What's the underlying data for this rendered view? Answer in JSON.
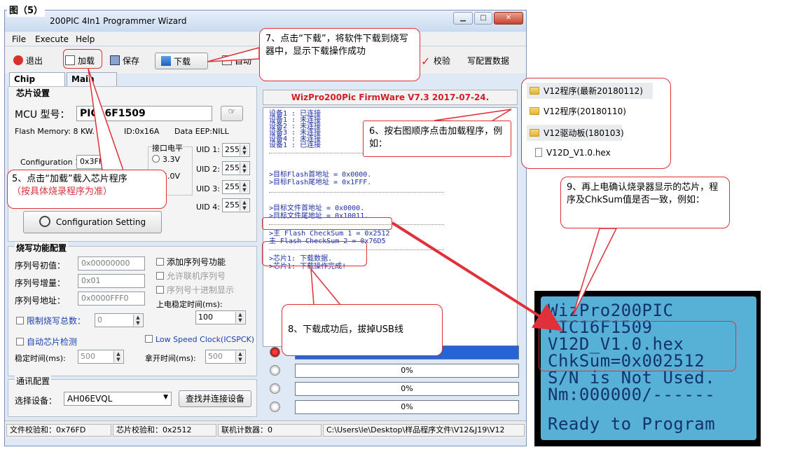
{
  "figure_label": "图（5）",
  "window": {
    "title": "200PIC 4In1 Programmer Wizard",
    "menu": [
      "File",
      "Execute",
      "Help"
    ],
    "toolbar": {
      "exit": "退出",
      "load": "加载",
      "save": "保存",
      "download": "下载",
      "auto": "自动",
      "verify": "校验",
      "write_config": "写配置数据"
    },
    "tabs": [
      "Chip Setting",
      "Main Flash"
    ],
    "chip": {
      "group_title": "芯片设置",
      "mcu_label": "MCU 型号：",
      "mcu_value": "PIC16F1509",
      "flash_memory": "Flash Memory: 8 KW.",
      "id": "ID:0x16A",
      "eeprom": "Data EEP:NILL",
      "config_label": "Configuration 1:",
      "config_value": "0x3FF",
      "voltage_group": "接口电平",
      "v33": "3.3V",
      "v5": "5.0V",
      "uids": [
        {
          "label": "UID 1:",
          "value": "255"
        },
        {
          "label": "UID 2:",
          "value": "255"
        },
        {
          "label": "UID 3:",
          "value": "255"
        },
        {
          "label": "UID 4:",
          "value": "255"
        }
      ],
      "config_button": "Configuration Setting"
    },
    "burn": {
      "group_title": "烧写功能配置",
      "serial_init_label": "序列号初值：",
      "serial_init_value": "0x00000000",
      "serial_inc_label": "序列号增量：",
      "serial_inc_value": "0x01",
      "serial_addr_label": "序列号地址：",
      "serial_addr_value": "0x0000FFF0",
      "add_serial": "添加序列号功能",
      "allow_online": "允许联机序列号",
      "decimal_show": "序列号十进制显示",
      "power_delay_label": "上电稳定时间(ms):",
      "power_delay_value": "100",
      "limit_total": "限制烧写总数：",
      "limit_value": "0",
      "auto_detect": "自动芯片检测",
      "low_speed": "Low Speed Clock(ICSPCK)",
      "stable_label": "稳定时间(ms):",
      "stable_value": "500",
      "release_label": "拿开时间(ms):",
      "release_value": "500"
    },
    "comm": {
      "group_title": "通讯配置",
      "device_label": "选择设备：",
      "device_value": "AH06EVQL",
      "connect_button": "查找并连接设备"
    },
    "firmware_banner": "WizPro200Pic FirmWare V7.3 2017-07-24.",
    "log": [
      "设备1 : 已连接",
      "设备1 : 未连接",
      "设备2 : 未连接",
      "设备3 : 未连接",
      "设备4 : 未连接",
      "设备1 : 已连接",
      ">目标Flash首地址 = 0x0000.",
      ">目标Flash尾地址 = 0x1FFF.",
      ">目标文件首地址 = 0x0000.",
      ">目标文件尾地址 = 0x10011.",
      ">主 Flash CheckSum 1 = 0x2512",
      " 主 Flash CheckSum 2 = 0x76D5",
      ">芯片1: 下载数据.",
      ">芯片1: 下载操作完成!"
    ],
    "progress": [
      {
        "label": "",
        "value": 1.0
      },
      {
        "label": "0%",
        "value": 0
      },
      {
        "label": "0%",
        "value": 0
      },
      {
        "label": "0%",
        "value": 0
      }
    ],
    "status": {
      "file_checksum": "文件校验和：0x76FD",
      "chip_checksum": "芯片校验和：0x2512",
      "online_counter": "联机计数器：0",
      "path": "C:\\Users\\le\\Desktop\\样品程序文件\\V12&J19\\V12"
    }
  },
  "callouts": {
    "c5_line1": "5、点击“加载”载入芯片程序",
    "c5_line2": "（按具体烧录程序为准）",
    "c6": "6、按右图顺序点击加载程序，例如：",
    "c7": "7、点击“下载”，将软件下载到烧写器中，显示下载操作成功",
    "c8": "8、下载成功后，拔掉USB线",
    "c9": "9、再上电确认烧录器显示的芯片，程序及ChkSum值是否一致，例如："
  },
  "files": [
    {
      "name": "V12程序(最新20180112)",
      "type": "folder"
    },
    {
      "name": "V12程序(20180110)",
      "type": "folder"
    },
    {
      "name": "V12驱动板(180103)",
      "type": "folder"
    },
    {
      "name": "V12D_V1.0.hex",
      "type": "file"
    }
  ],
  "lcd": [
    "WizPro200PIC",
    "PIC16F1509",
    "V12D_V1.0.hex",
    "ChkSum=0x002512",
    "S/N is Not Used.",
    "Nm:000000/------",
    "",
    "Ready to Program"
  ],
  "colors": {
    "accent_red": "#e0303a",
    "log_blue": "#1c2fa6",
    "lcd_bg": "#57b0d6",
    "progress_blue": "#2563d6"
  }
}
